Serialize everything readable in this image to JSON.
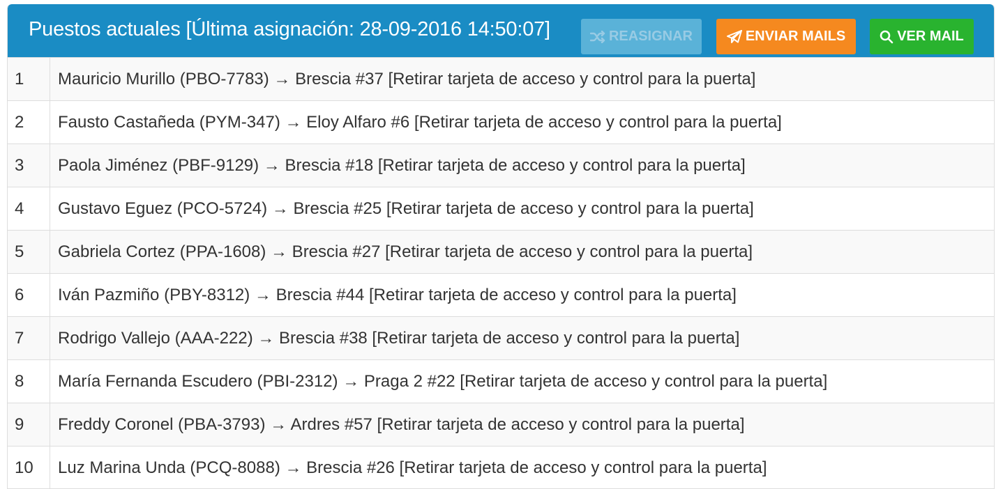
{
  "panel": {
    "title": "Puestos actuales [Última asignación: 28-09-2016 14:50:07]",
    "buttons": {
      "reassign": {
        "label": "REASIGNAR",
        "icon": "shuffle-icon"
      },
      "send_mails": {
        "label": "ENVIAR MAILS",
        "icon": "paper-plane-icon"
      },
      "view_mail": {
        "label": "VER MAIL",
        "icon": "search-icon"
      }
    }
  },
  "colors": {
    "header": "#1a8cc4",
    "reassign": "#8fd2ea",
    "send_mails": "#f5891f",
    "view_mail": "#29b32f"
  },
  "rows": [
    {
      "num": "1",
      "text": "Mauricio Murillo (PBO-7783) → Brescia #37 [Retirar tarjeta de acceso y control para la puerta]"
    },
    {
      "num": "2",
      "text": "Fausto Castañeda (PYM-347) → Eloy Alfaro #6 [Retirar tarjeta de acceso y control para la puerta]"
    },
    {
      "num": "3",
      "text": "Paola Jiménez (PBF-9129) → Brescia #18 [Retirar tarjeta de acceso y control para la puerta]"
    },
    {
      "num": "4",
      "text": "Gustavo Eguez (PCO-5724) → Brescia #25 [Retirar tarjeta de acceso y control para la puerta]"
    },
    {
      "num": "5",
      "text": "Gabriela Cortez (PPA-1608) → Brescia #27 [Retirar tarjeta de acceso y control para la puerta]"
    },
    {
      "num": "6",
      "text": "Iván Pazmiño (PBY-8312) → Brescia #44 [Retirar tarjeta de acceso y control para la puerta]"
    },
    {
      "num": "7",
      "text": "Rodrigo Vallejo (AAA-222) → Brescia #38 [Retirar tarjeta de acceso y control para la puerta]"
    },
    {
      "num": "8",
      "text": "María Fernanda Escudero (PBI-2312) → Praga 2 #22 [Retirar tarjeta de acceso y control para la puerta]"
    },
    {
      "num": "9",
      "text": "Freddy Coronel (PBA-3793) → Ardres #57 [Retirar tarjeta de acceso y control para la puerta]"
    },
    {
      "num": "10",
      "text": "Luz Marina Unda (PCQ-8088) → Brescia #26 [Retirar tarjeta de acceso y control para la puerta]"
    }
  ]
}
